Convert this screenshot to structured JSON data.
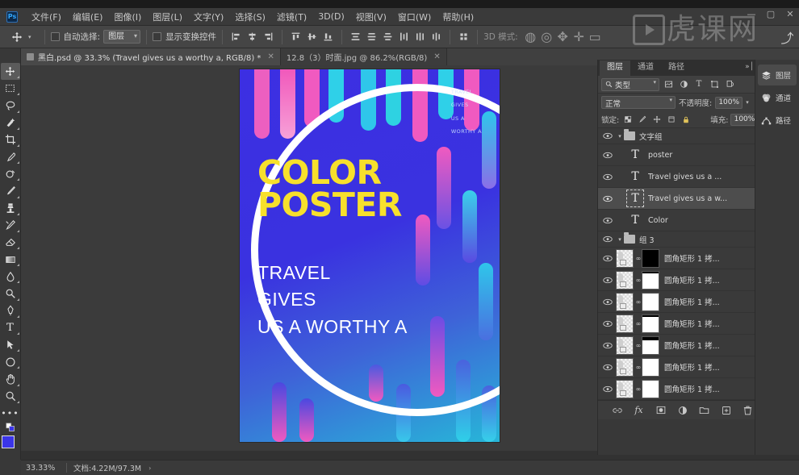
{
  "app": {
    "name": "Adobe Photoshop",
    "badge": "Ps",
    "accent": "#31a8ff"
  },
  "menubar": {
    "items": [
      {
        "label": "文件(F)",
        "name": "menu-file"
      },
      {
        "label": "编辑(E)",
        "name": "menu-edit"
      },
      {
        "label": "图像(I)",
        "name": "menu-image"
      },
      {
        "label": "图层(L)",
        "name": "menu-layer"
      },
      {
        "label": "文字(Y)",
        "name": "menu-type"
      },
      {
        "label": "选择(S)",
        "name": "menu-select"
      },
      {
        "label": "滤镜(T)",
        "name": "menu-filter"
      },
      {
        "label": "3D(D)",
        "name": "menu-3d"
      },
      {
        "label": "视图(V)",
        "name": "menu-view"
      },
      {
        "label": "窗口(W)",
        "name": "menu-window"
      },
      {
        "label": "帮助(H)",
        "name": "menu-help"
      }
    ]
  },
  "window_controls": {
    "minimize": "—",
    "maximize": "▢",
    "close": "✕"
  },
  "watermark": {
    "text": "虎课网",
    "glyph1": "虎",
    "glyph2": "课",
    "glyph3": "网"
  },
  "options_bar": {
    "tool_icon": "move-tool-icon",
    "auto_select_label": "自动选择:",
    "auto_select_value": "图层",
    "show_transform_label": "显示变换控件",
    "align_buttons": [
      {
        "name": "align-left-edges",
        "glyph": "⊨"
      },
      {
        "name": "align-horizontal-centers",
        "glyph": "⊞"
      },
      {
        "name": "align-right-edges",
        "glyph": "⊩"
      },
      {
        "name": "align-top-edges",
        "glyph": "⊤"
      },
      {
        "name": "align-vertical-centers",
        "glyph": "⊟"
      },
      {
        "name": "align-bottom-edges",
        "glyph": "⊥"
      }
    ],
    "distribute_buttons": [
      {
        "name": "distribute-top",
        "glyph": "≡"
      },
      {
        "name": "distribute-vcenter",
        "glyph": "≣"
      },
      {
        "name": "distribute-bottom",
        "glyph": "≡"
      },
      {
        "name": "distribute-left",
        "glyph": "⫼"
      },
      {
        "name": "distribute-hcenter",
        "glyph": "⫼"
      },
      {
        "name": "distribute-right",
        "glyph": "⫼"
      }
    ],
    "extra_buttons": [
      {
        "name": "align-and-distribute-options",
        "glyph": "⋮⋮"
      },
      {
        "name": "3d-mode-label",
        "glyph": "3D 模式:"
      },
      {
        "name": "3d-orbit",
        "glyph": "◍"
      },
      {
        "name": "3d-roll",
        "glyph": "◎"
      },
      {
        "name": "3d-pan",
        "glyph": "✥"
      },
      {
        "name": "3d-slide",
        "glyph": "✛"
      },
      {
        "name": "3d-scale",
        "glyph": "▭"
      }
    ],
    "share_icon": "share-icon"
  },
  "tabs": [
    {
      "title": "黑白.psd @ 33.3% (Travel   gives    us a worthy a, RGB/8) *",
      "active": true,
      "name": "document-tab-heibai"
    },
    {
      "title": "12.8（3）时面.jpg @ 86.2%(RGB/8)",
      "active": false,
      "name": "document-tab-shimian"
    }
  ],
  "toolbar": {
    "tools": [
      {
        "name": "move-tool",
        "glyph": "✛",
        "active": true
      },
      {
        "name": "rectangular-marquee-tool",
        "glyph": "▢",
        "active": false
      },
      {
        "name": "lasso-tool",
        "glyph": "◯",
        "active": false
      },
      {
        "name": "quick-selection-tool",
        "glyph": "✎",
        "active": false
      },
      {
        "name": "crop-tool",
        "glyph": "⌗",
        "active": false
      },
      {
        "name": "eyedropper-tool",
        "glyph": "⚲",
        "active": false
      },
      {
        "name": "spot-healing-brush-tool",
        "glyph": "◔",
        "active": false
      },
      {
        "name": "brush-tool",
        "glyph": "✐",
        "active": false
      },
      {
        "name": "clone-stamp-tool",
        "glyph": "⌸",
        "active": false
      },
      {
        "name": "history-brush-tool",
        "glyph": "✄",
        "active": false
      },
      {
        "name": "eraser-tool",
        "glyph": "◧",
        "active": false
      },
      {
        "name": "gradient-tool",
        "glyph": "▨",
        "active": false
      },
      {
        "name": "blur-tool",
        "glyph": "◌",
        "active": false
      },
      {
        "name": "dodge-tool",
        "glyph": "⚯",
        "active": false
      },
      {
        "name": "pen-tool",
        "glyph": "✒",
        "active": false
      },
      {
        "name": "horizontal-type-tool",
        "glyph": "T",
        "active": false
      },
      {
        "name": "path-selection-tool",
        "glyph": "➤",
        "active": false
      },
      {
        "name": "ellipse-shape-tool",
        "glyph": "◯",
        "active": false
      },
      {
        "name": "hand-tool",
        "glyph": "✋",
        "active": false
      },
      {
        "name": "zoom-tool",
        "glyph": "⌕",
        "active": false
      },
      {
        "name": "edit-toolbar-more",
        "glyph": "•••",
        "active": false
      }
    ],
    "foreground_color": "#3b35e8",
    "background_color": "#ffffff",
    "quick_mask_name": "quick-mask-mode"
  },
  "canvas": {
    "poster": {
      "title_line1": "COLOR",
      "title_line2": "POSTER",
      "subtitle_line1": "TRAVEL",
      "subtitle_line2": "GIVES",
      "subtitle_line3": "US A WORTHY A",
      "corner_text_lines": [
        "TRAVEL",
        "GIVES",
        "US A",
        "WORTHY A"
      ],
      "title_color": "#f7e02c",
      "subtitle_color": "#ffffff",
      "background_color": "#3b30e0",
      "circle_color": "#ffffff"
    },
    "cursor": "move-cursor"
  },
  "layers_panel": {
    "tabs": [
      {
        "label": "图层",
        "active": true,
        "name": "panel-tab-layers"
      },
      {
        "label": "通道",
        "active": false,
        "name": "panel-tab-channels"
      },
      {
        "label": "路径",
        "active": false,
        "name": "panel-tab-paths"
      }
    ],
    "menu_icon": "panel-menu-icon",
    "collapse_icon": "panel-collapse-icon",
    "filter": {
      "search_icon": "search-icon",
      "type_label": "类型",
      "buttons": [
        {
          "name": "filter-pixel-layers",
          "glyph": "▣"
        },
        {
          "name": "filter-adjustment-layers",
          "glyph": "◐"
        },
        {
          "name": "filter-type-layers",
          "glyph": "T"
        },
        {
          "name": "filter-shape-layers",
          "glyph": "▱"
        },
        {
          "name": "filter-smart-objects",
          "glyph": "⬚"
        }
      ],
      "toggle_name": "filter-toggle-switch"
    },
    "blend_mode_label": "正常",
    "opacity_label": "不透明度:",
    "opacity_value": "100%",
    "lock_label": "锁定:",
    "lock_buttons": [
      {
        "name": "lock-transparent-pixels",
        "glyph": "⊞"
      },
      {
        "name": "lock-image-pixels",
        "glyph": "✎"
      },
      {
        "name": "lock-position",
        "glyph": "✛"
      },
      {
        "name": "lock-artboard-nesting",
        "glyph": "⊡"
      },
      {
        "name": "lock-all",
        "glyph": "🔒"
      }
    ],
    "fill_label": "填充:",
    "fill_value": "100%",
    "layers": [
      {
        "kind": "group",
        "name": "文字组",
        "visible": true,
        "expanded": true,
        "selected": false
      },
      {
        "kind": "type",
        "name": "poster",
        "visible": true,
        "selected": false,
        "indent": 1
      },
      {
        "kind": "type",
        "name": "Travel   gives    us a ...",
        "visible": true,
        "selected": false,
        "indent": 1
      },
      {
        "kind": "type",
        "name": "Travel   gives    us a w...",
        "visible": true,
        "selected": true,
        "indent": 1
      },
      {
        "kind": "type",
        "name": "Color",
        "visible": true,
        "selected": false,
        "indent": 1
      },
      {
        "kind": "group",
        "name": "组 3",
        "visible": true,
        "expanded": true,
        "selected": false
      },
      {
        "kind": "shape",
        "name": "圆角矩形 1 拷...",
        "visible": true,
        "selected": false,
        "mask": "black",
        "indent": 1
      },
      {
        "kind": "shape",
        "name": "圆角矩形 1 拷...",
        "visible": true,
        "selected": false,
        "mask": "tophalf",
        "indent": 1
      },
      {
        "kind": "shape",
        "name": "圆角矩形 1 拷...",
        "visible": true,
        "selected": false,
        "mask": "white",
        "indent": 1
      },
      {
        "kind": "shape",
        "name": "圆角矩形 1 拷...",
        "visible": true,
        "selected": false,
        "mask": "tophalf2",
        "indent": 1
      },
      {
        "kind": "shape",
        "name": "圆角矩形 1 拷...",
        "visible": true,
        "selected": false,
        "mask": "tophalf",
        "indent": 1
      },
      {
        "kind": "shape",
        "name": "圆角矩形 1 拷...",
        "visible": true,
        "selected": false,
        "mask": "white",
        "indent": 1
      },
      {
        "kind": "shape",
        "name": "圆角矩形 1 拷...",
        "visible": true,
        "selected": false,
        "mask": "white",
        "indent": 1
      }
    ],
    "bottom_buttons": [
      {
        "name": "link-layers-button",
        "glyph": "⛓"
      },
      {
        "name": "layer-style-button",
        "glyph": "fx"
      },
      {
        "name": "add-layer-mask-button",
        "glyph": "▣"
      },
      {
        "name": "new-adjustment-layer-button",
        "glyph": "◑"
      },
      {
        "name": "new-group-button",
        "glyph": "▤"
      },
      {
        "name": "new-layer-button",
        "glyph": "⊞"
      },
      {
        "name": "delete-layer-button",
        "glyph": "🗑"
      }
    ]
  },
  "icon_dock": [
    {
      "label": "图层",
      "icon": "layers-icon",
      "active": true,
      "name": "dock-layers"
    },
    {
      "label": "通道",
      "icon": "channels-icon",
      "active": false,
      "name": "dock-channels"
    },
    {
      "label": "路径",
      "icon": "paths-icon",
      "active": false,
      "name": "dock-paths"
    }
  ],
  "status_bar": {
    "zoom": "33.33%",
    "doc_label": "文档:4.22M/97.3M",
    "expand_glyph": "›"
  }
}
